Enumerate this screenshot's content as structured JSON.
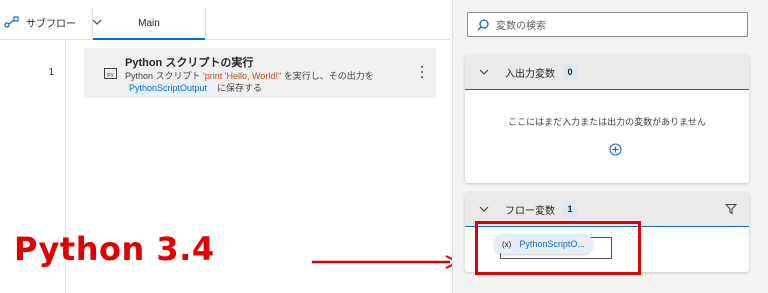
{
  "editor": {
    "subflow_label": "サブフロー",
    "main_tab_label": "Main",
    "line_number": "1",
    "action": {
      "title": "Python スクリプトの実行",
      "desc_prefix": "Python スクリプト ",
      "desc_code": "'print 'Hello, World!''",
      "desc_suffix": " を実行し、その出力を",
      "output_var": "PythonScriptOutput",
      "desc_tail": "に保存する"
    }
  },
  "annotation": {
    "overlay_text": "Python 3.4",
    "color": "#e00000"
  },
  "variables": {
    "search_placeholder": "変数の検索",
    "io_panel": {
      "title": "入出力変数",
      "count": "0",
      "empty_message": "ここにはまだ入力または出力の変数がありません"
    },
    "flow_panel": {
      "title": "フロー変数",
      "count": "1",
      "items": [
        {
          "icon": "(x)",
          "name": "PythonScriptO..."
        }
      ]
    }
  },
  "colors": {
    "accent": "#0f6cbd",
    "annotation_red": "#e00000",
    "card_bg": "#f0f0f0",
    "pane_bg": "#f3f3f3"
  },
  "icons": [
    "subflow-icon",
    "chevron-down-icon",
    "python-script-icon",
    "more-icon",
    "search-icon",
    "add-icon",
    "filter-icon",
    "variable-icon",
    "arrow-right-icon"
  ]
}
